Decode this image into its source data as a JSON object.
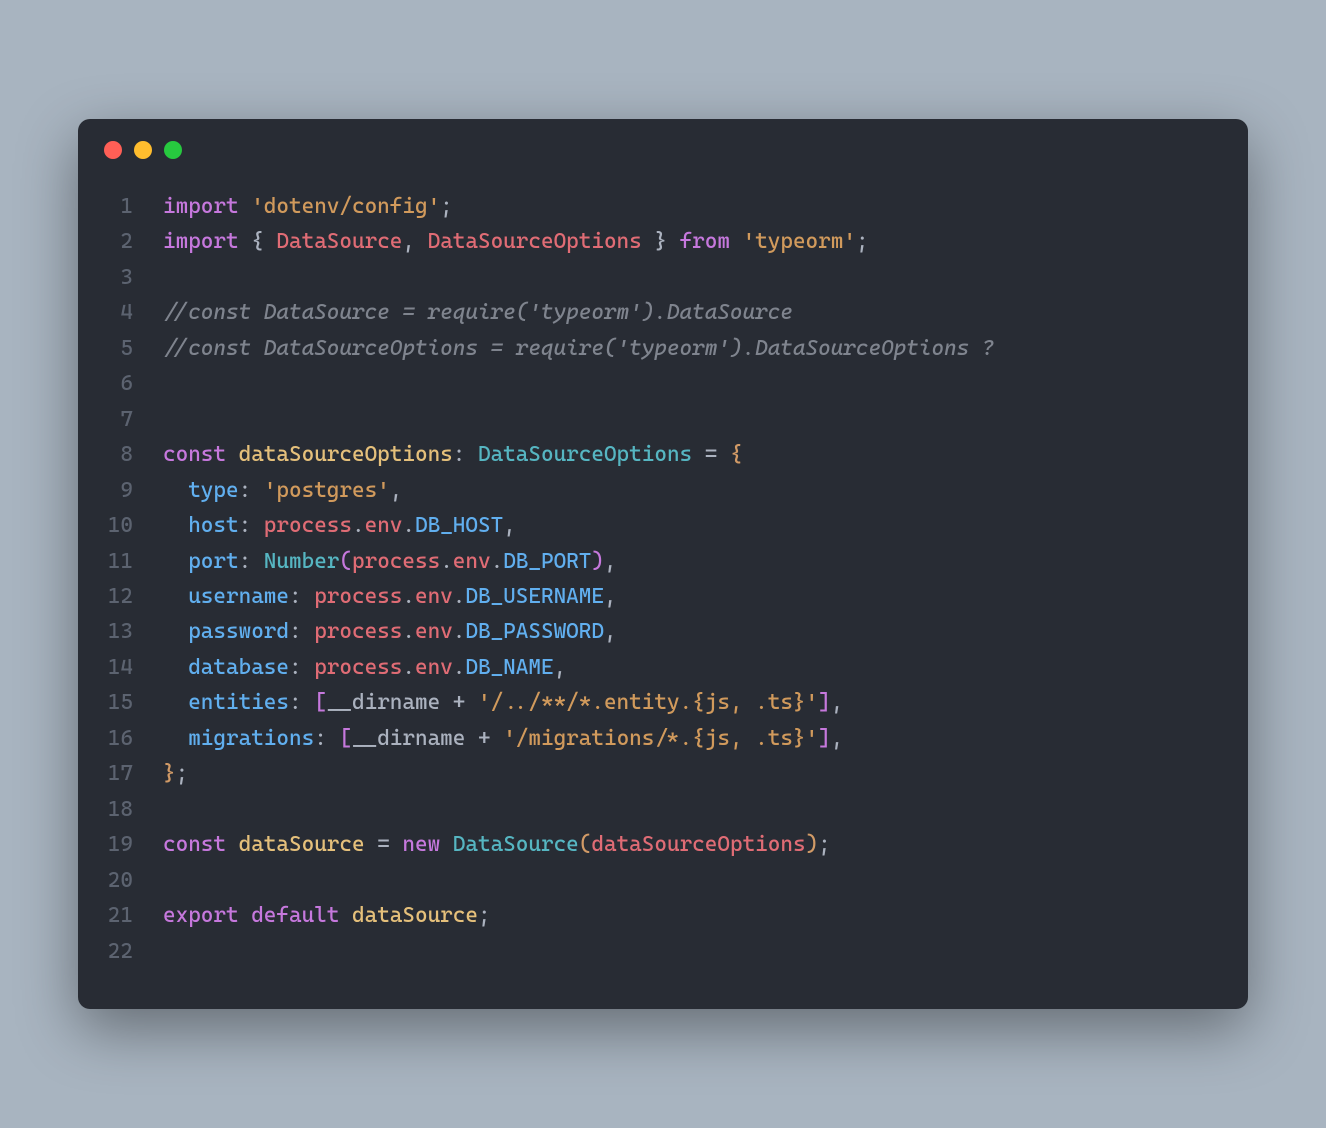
{
  "titlebar": {
    "dots": [
      "red",
      "yellow",
      "green"
    ]
  },
  "code": {
    "lines": [
      {
        "n": 1,
        "tokens": [
          {
            "c": "kw-import",
            "t": "import"
          },
          {
            "c": "",
            "t": " "
          },
          {
            "c": "string",
            "t": "'dotenv/config'"
          },
          {
            "c": "punct",
            "t": ";"
          }
        ]
      },
      {
        "n": 2,
        "tokens": [
          {
            "c": "kw-import",
            "t": "import"
          },
          {
            "c": "",
            "t": " "
          },
          {
            "c": "punct",
            "t": "{ "
          },
          {
            "c": "ident",
            "t": "DataSource"
          },
          {
            "c": "punct",
            "t": ", "
          },
          {
            "c": "ident",
            "t": "DataSourceOptions"
          },
          {
            "c": "punct",
            "t": " } "
          },
          {
            "c": "kw-from",
            "t": "from"
          },
          {
            "c": "",
            "t": " "
          },
          {
            "c": "string",
            "t": "'typeorm'"
          },
          {
            "c": "punct",
            "t": ";"
          }
        ]
      },
      {
        "n": 3,
        "tokens": []
      },
      {
        "n": 4,
        "tokens": [
          {
            "c": "comment",
            "t": "//const DataSource = require('typeorm').DataSource"
          }
        ]
      },
      {
        "n": 5,
        "tokens": [
          {
            "c": "comment",
            "t": "//const DataSourceOptions = require('typeorm').DataSourceOptions ?"
          }
        ]
      },
      {
        "n": 6,
        "tokens": []
      },
      {
        "n": 7,
        "tokens": []
      },
      {
        "n": 8,
        "tokens": [
          {
            "c": "kw-const",
            "t": "const"
          },
          {
            "c": "",
            "t": " "
          },
          {
            "c": "class",
            "t": "dataSourceOptions"
          },
          {
            "c": "punct",
            "t": ": "
          },
          {
            "c": "type",
            "t": "DataSourceOptions"
          },
          {
            "c": "punct",
            "t": " = "
          },
          {
            "c": "paren",
            "t": "{"
          }
        ]
      },
      {
        "n": 9,
        "tokens": [
          {
            "c": "",
            "t": "  "
          },
          {
            "c": "prop",
            "t": "type"
          },
          {
            "c": "punct",
            "t": ": "
          },
          {
            "c": "string",
            "t": "'postgres'"
          },
          {
            "c": "punct",
            "t": ","
          }
        ]
      },
      {
        "n": 10,
        "tokens": [
          {
            "c": "",
            "t": "  "
          },
          {
            "c": "prop",
            "t": "host"
          },
          {
            "c": "punct",
            "t": ": "
          },
          {
            "c": "ident",
            "t": "process"
          },
          {
            "c": "punct",
            "t": "."
          },
          {
            "c": "ident",
            "t": "env"
          },
          {
            "c": "punct",
            "t": "."
          },
          {
            "c": "var",
            "t": "DB_HOST"
          },
          {
            "c": "punct",
            "t": ","
          }
        ]
      },
      {
        "n": 11,
        "tokens": [
          {
            "c": "",
            "t": "  "
          },
          {
            "c": "prop",
            "t": "port"
          },
          {
            "c": "punct",
            "t": ": "
          },
          {
            "c": "func",
            "t": "Number"
          },
          {
            "c": "brace",
            "t": "("
          },
          {
            "c": "ident",
            "t": "process"
          },
          {
            "c": "punct",
            "t": "."
          },
          {
            "c": "ident",
            "t": "env"
          },
          {
            "c": "punct",
            "t": "."
          },
          {
            "c": "var",
            "t": "DB_PORT"
          },
          {
            "c": "brace",
            "t": ")"
          },
          {
            "c": "punct",
            "t": ","
          }
        ]
      },
      {
        "n": 12,
        "tokens": [
          {
            "c": "",
            "t": "  "
          },
          {
            "c": "prop",
            "t": "username"
          },
          {
            "c": "punct",
            "t": ": "
          },
          {
            "c": "ident",
            "t": "process"
          },
          {
            "c": "punct",
            "t": "."
          },
          {
            "c": "ident",
            "t": "env"
          },
          {
            "c": "punct",
            "t": "."
          },
          {
            "c": "var",
            "t": "DB_USERNAME"
          },
          {
            "c": "punct",
            "t": ","
          }
        ]
      },
      {
        "n": 13,
        "tokens": [
          {
            "c": "",
            "t": "  "
          },
          {
            "c": "prop",
            "t": "password"
          },
          {
            "c": "punct",
            "t": ": "
          },
          {
            "c": "ident",
            "t": "process"
          },
          {
            "c": "punct",
            "t": "."
          },
          {
            "c": "ident",
            "t": "env"
          },
          {
            "c": "punct",
            "t": "."
          },
          {
            "c": "var",
            "t": "DB_PASSWORD"
          },
          {
            "c": "punct",
            "t": ","
          }
        ]
      },
      {
        "n": 14,
        "tokens": [
          {
            "c": "",
            "t": "  "
          },
          {
            "c": "prop",
            "t": "database"
          },
          {
            "c": "punct",
            "t": ": "
          },
          {
            "c": "ident",
            "t": "process"
          },
          {
            "c": "punct",
            "t": "."
          },
          {
            "c": "ident",
            "t": "env"
          },
          {
            "c": "punct",
            "t": "."
          },
          {
            "c": "var",
            "t": "DB_NAME"
          },
          {
            "c": "punct",
            "t": ","
          }
        ]
      },
      {
        "n": 15,
        "tokens": [
          {
            "c": "",
            "t": "  "
          },
          {
            "c": "prop",
            "t": "entities"
          },
          {
            "c": "punct",
            "t": ": "
          },
          {
            "c": "brace",
            "t": "["
          },
          {
            "c": "dirname",
            "t": "__dirname"
          },
          {
            "c": "punct",
            "t": " + "
          },
          {
            "c": "string",
            "t": "'/../**/*.entity.{js, .ts}'"
          },
          {
            "c": "brace",
            "t": "]"
          },
          {
            "c": "punct",
            "t": ","
          }
        ]
      },
      {
        "n": 16,
        "tokens": [
          {
            "c": "",
            "t": "  "
          },
          {
            "c": "prop",
            "t": "migrations"
          },
          {
            "c": "punct",
            "t": ": "
          },
          {
            "c": "brace",
            "t": "["
          },
          {
            "c": "dirname",
            "t": "__dirname"
          },
          {
            "c": "punct",
            "t": " + "
          },
          {
            "c": "string",
            "t": "'/migrations/*.{js, .ts}'"
          },
          {
            "c": "brace",
            "t": "]"
          },
          {
            "c": "punct",
            "t": ","
          }
        ]
      },
      {
        "n": 17,
        "tokens": [
          {
            "c": "paren",
            "t": "}"
          },
          {
            "c": "punct",
            "t": ";"
          }
        ]
      },
      {
        "n": 18,
        "tokens": []
      },
      {
        "n": 19,
        "tokens": [
          {
            "c": "kw-const",
            "t": "const"
          },
          {
            "c": "",
            "t": " "
          },
          {
            "c": "class",
            "t": "dataSource"
          },
          {
            "c": "punct",
            "t": " = "
          },
          {
            "c": "kw-new",
            "t": "new"
          },
          {
            "c": "",
            "t": " "
          },
          {
            "c": "type",
            "t": "DataSource"
          },
          {
            "c": "paren",
            "t": "("
          },
          {
            "c": "ident",
            "t": "dataSourceOptions"
          },
          {
            "c": "paren",
            "t": ")"
          },
          {
            "c": "punct",
            "t": ";"
          }
        ]
      },
      {
        "n": 20,
        "tokens": []
      },
      {
        "n": 21,
        "tokens": [
          {
            "c": "kw-export",
            "t": "export"
          },
          {
            "c": "",
            "t": " "
          },
          {
            "c": "kw-default",
            "t": "default"
          },
          {
            "c": "",
            "t": " "
          },
          {
            "c": "class",
            "t": "dataSource"
          },
          {
            "c": "punct",
            "t": ";"
          }
        ]
      },
      {
        "n": 22,
        "tokens": []
      }
    ]
  }
}
